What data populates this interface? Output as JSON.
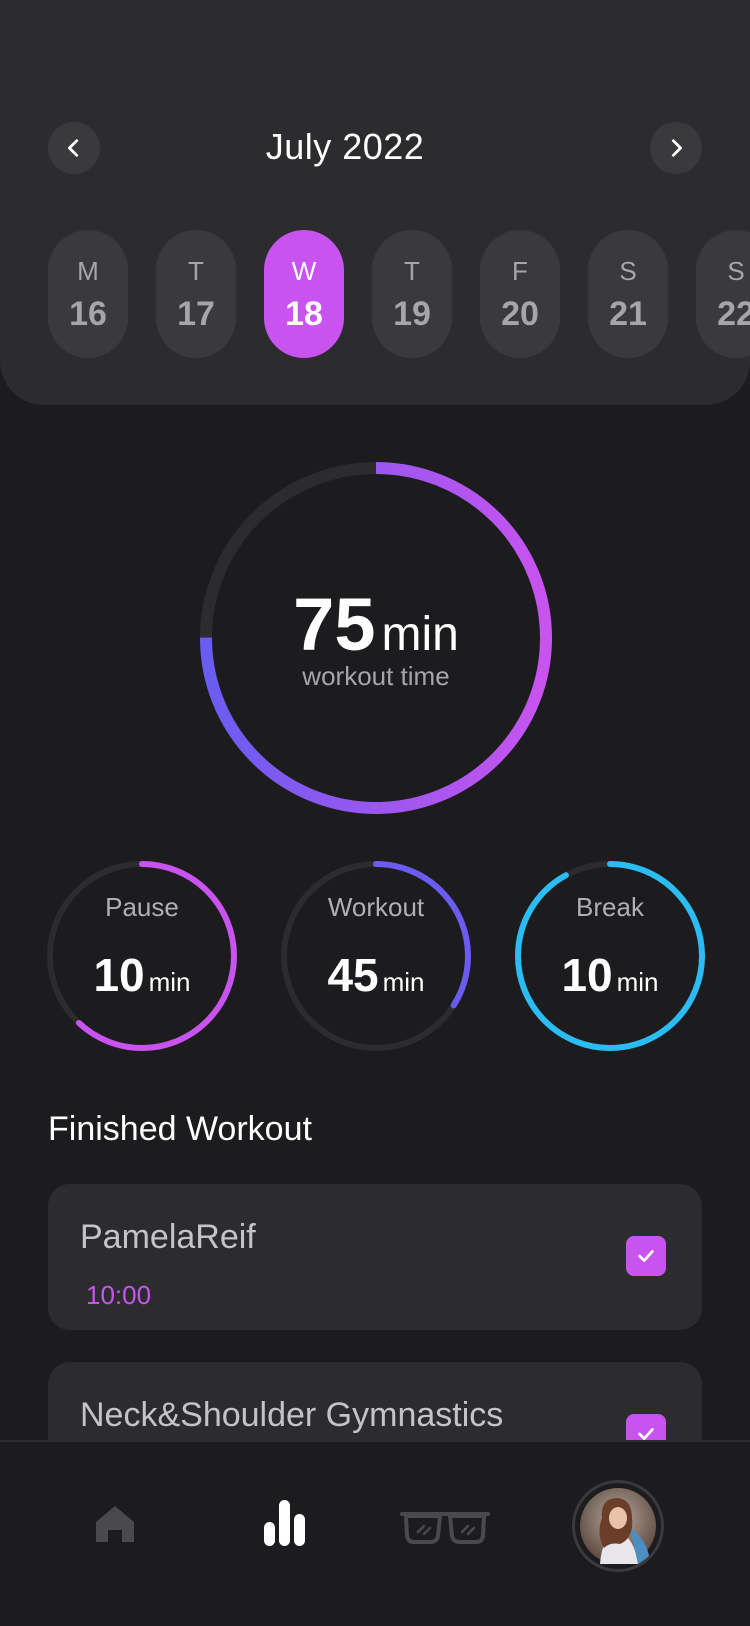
{
  "header": {
    "month": "July 2022",
    "prev_icon": "chevron-left-icon",
    "next_icon": "chevron-right-icon",
    "days": [
      {
        "name": "M",
        "num": "16",
        "active": false
      },
      {
        "name": "T",
        "num": "17",
        "active": false
      },
      {
        "name": "W",
        "num": "18",
        "active": true
      },
      {
        "name": "T",
        "num": "19",
        "active": false
      },
      {
        "name": "F",
        "num": "20",
        "active": false
      },
      {
        "name": "S",
        "num": "21",
        "active": false
      },
      {
        "name": "S",
        "num": "22",
        "active": false
      }
    ]
  },
  "summary": {
    "value": "75",
    "unit": "min",
    "label": "workout time",
    "progress": 0.75
  },
  "stats": [
    {
      "label": "Pause",
      "value": "10",
      "unit": "min",
      "progress": 0.62,
      "color": "#c953ef"
    },
    {
      "label": "Workout",
      "value": "45",
      "unit": "min",
      "progress": 0.34,
      "color": "#6a5cf0"
    },
    {
      "label": "Break",
      "value": "10",
      "unit": "min",
      "progress": 0.92,
      "color": "#2bbcf4"
    }
  ],
  "finished": {
    "title": "Finished Workout",
    "items": [
      {
        "title": "PamelaReif",
        "time": "10:00",
        "checked": true
      },
      {
        "title": "Neck&Shoulder Gymnastics",
        "time": "",
        "checked": true
      }
    ]
  },
  "nav": {
    "items": [
      "home-icon",
      "stats-icon",
      "glasses-icon",
      "avatar"
    ],
    "active": "stats-icon"
  },
  "colors": {
    "accent": "#c953ef",
    "indigo": "#6a5cf0",
    "cyan": "#2bbcf4",
    "background": "#1c1c1f",
    "card": "#2c2c2f"
  }
}
